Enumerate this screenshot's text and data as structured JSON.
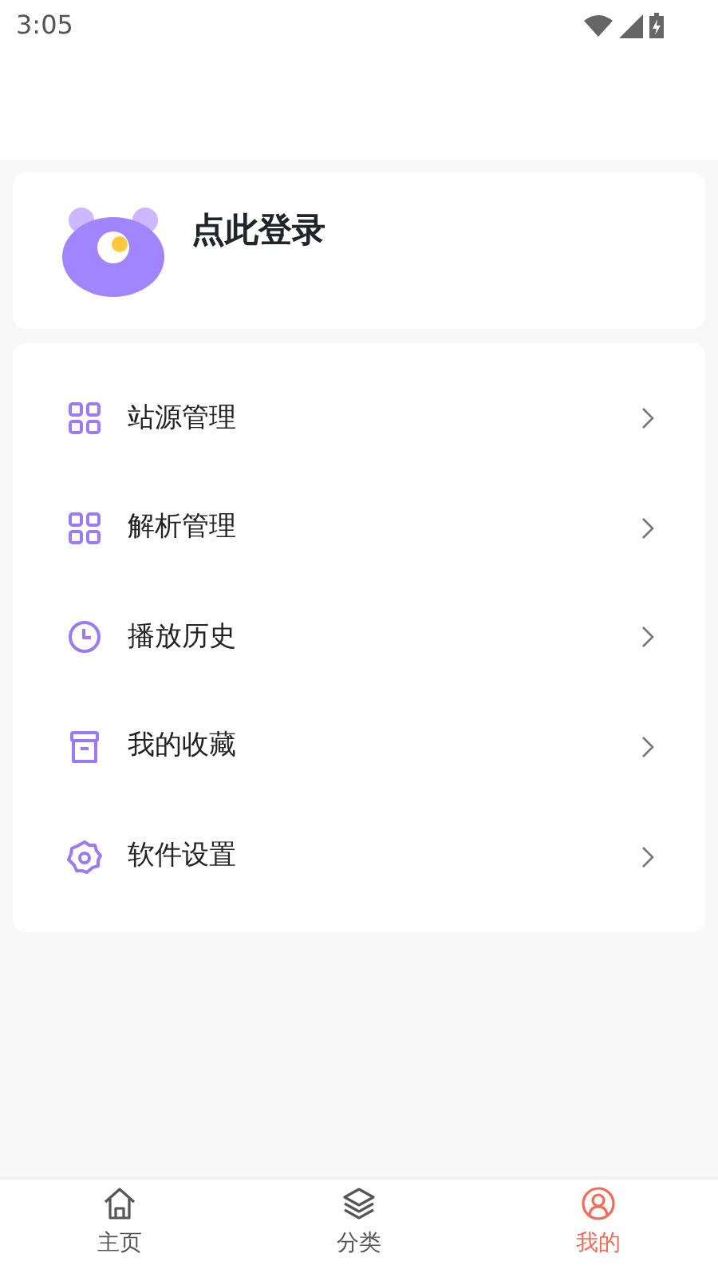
{
  "status_bar": {
    "time": "3:05"
  },
  "profile": {
    "login_text": "点此登录"
  },
  "menu": [
    {
      "kind": "grid",
      "label": "站源管理"
    },
    {
      "kind": "grid",
      "label": "解析管理"
    },
    {
      "kind": "clock",
      "label": "播放历史"
    },
    {
      "kind": "archive",
      "label": "我的收藏"
    },
    {
      "kind": "gear",
      "label": "软件设置"
    }
  ],
  "tabs": [
    {
      "kind": "home",
      "label": "主页",
      "selected": false
    },
    {
      "kind": "layers",
      "label": "分类",
      "selected": false
    },
    {
      "kind": "user",
      "label": "我的",
      "selected": true
    }
  ]
}
